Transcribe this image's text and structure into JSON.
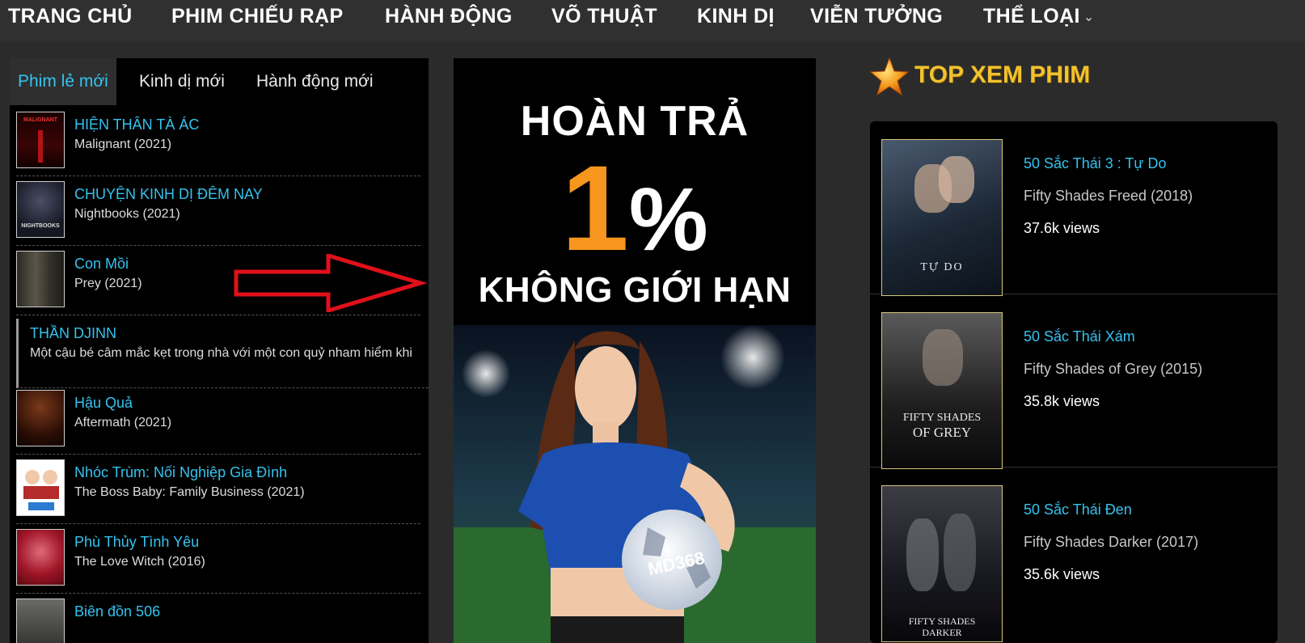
{
  "nav": {
    "items": [
      "TRANG CHỦ",
      "PHIM CHIẾU RẠP",
      "HÀNH ĐỘNG",
      "VÕ THUẬT",
      "KINH DỊ",
      "VIỄN TƯỞNG",
      "THỂ LOẠI"
    ]
  },
  "tabs": [
    "Phim lẻ mới",
    "Kinh dị mới",
    "Hành động mới"
  ],
  "movies": [
    {
      "title": "HIỆN THÂN TÀ ÁC",
      "sub": "Malignant (2021)"
    },
    {
      "title": "CHUYỆN KINH DỊ ĐÊM NAY",
      "sub": "Nightbooks (2021)"
    },
    {
      "title": "Con Mồi",
      "sub": "Prey (2021)"
    },
    {
      "title": "THẦN DJINN",
      "sub": "Một cậu bé câm mắc kẹt trong nhà với một con quỷ nham hiểm khi"
    },
    {
      "title": "Hậu Quả",
      "sub": "Aftermath (2021)"
    },
    {
      "title": "Nhóc Trùm: Nối Nghiệp Gia Đình",
      "sub": "The Boss Baby: Family Business (2021)"
    },
    {
      "title": "Phù Thủy Tình Yêu",
      "sub": "The Love Witch (2016)"
    },
    {
      "title": "Biên đồn 506",
      "sub": ""
    }
  ],
  "ad": {
    "line1": "HOÀN TRẢ",
    "line2": "1",
    "line2_pct": "%",
    "line3": "KHÔNG GIỚI HẠN",
    "brand": "MD368"
  },
  "top": {
    "title": "TOP XEM PHIM",
    "items": [
      {
        "title": "50 Sắc Thái 3 : Tự Do",
        "orig": "Fifty Shades Freed (2018)",
        "views": "37.6k views"
      },
      {
        "title": "50 Sắc Thái Xám",
        "orig": "Fifty Shades of Grey (2015)",
        "views": "35.8k views"
      },
      {
        "title": "50 Sắc Thái Đen",
        "orig": "Fifty Shades Darker (2017)",
        "views": "35.6k views"
      }
    ]
  },
  "posters": {
    "p1": "TỰ DO",
    "p2a": "FIFTY SHADES",
    "p2b": "OF GREY",
    "p3a": "FIFTY SHADES",
    "p3b": "DARKER",
    "malignant": "MALIGNANT",
    "nightbooks": "NIGHTBOOKS"
  },
  "colors": {
    "accent": "#35c3ee",
    "gold": "#f2c12e",
    "orange": "#f6961e",
    "arrow": "#e0101a"
  }
}
